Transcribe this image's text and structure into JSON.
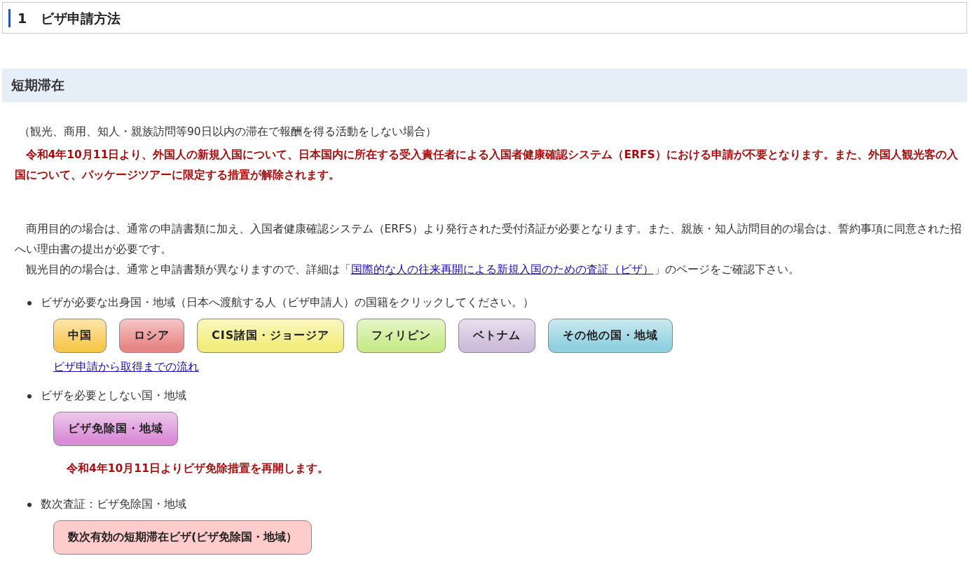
{
  "page_title": {
    "number": "1",
    "text": "ビザ申請方法"
  },
  "section": {
    "heading": "短期滞在",
    "intro": "（観光、商用、知人・親族訪問等90日以内の滞在で報酬を得る活動をしない場合）",
    "notice": "令和4年10月11日より、外国人の新規入国について、日本国内に所在する受入責任者による入国者健康確認システム（ERFS）における申請が不要となります。また、外国人観光客の入国について、パッケージツアーに限定する措置が解除されます。",
    "business_paragraph": "商用目的の場合は、通常の申請書類に加え、入国者健康確認システム（ERFS）より発行された受付済証が必要となります。また、親族・知人訪問目的の場合は、誓約事項に同意された招へい理由書の提出が必要です。",
    "tourism_paragraph": {
      "before": "観光目的の場合は、通常と申請書類が異なりますので、詳細は「",
      "link": "国際的な人の往来再開による新規入国のための査証（ビザ）",
      "after": "」のページをご確認下さい。"
    },
    "items": [
      {
        "label": "ビザが必要な出身国・地域（日本へ渡航する人（ビザ申請人）の国籍をクリックしてください。）",
        "buttons": [
          {
            "label": "中国",
            "color": "#f7c84f"
          },
          {
            "label": "ロシア",
            "color": "#e88585"
          },
          {
            "label": "CIS諸国・ジョージア",
            "color": "#f2ec7a"
          },
          {
            "label": "フィリピン",
            "color": "#c8ea8a"
          },
          {
            "label": "ベトナム",
            "color": "#cdbcd9"
          },
          {
            "label": "その他の国・地域",
            "color": "#8fd0df"
          }
        ],
        "link": "ビザ申請から取得までの流れ"
      },
      {
        "label": "ビザを必要としない国・地域",
        "buttons": [
          {
            "label": "ビザ免除国・地域",
            "color": "#d98bd6"
          }
        ],
        "note": "令和4年10月11日よりビザ免除措置を再開します。"
      },
      {
        "label": "数次査証：ビザ免除国・地域",
        "buttons": [
          {
            "label": "数次有効の短期滞在ビザ(ビザ免除国・地域）",
            "color": "#ffcccc",
            "kind": "flat"
          }
        ]
      }
    ]
  }
}
